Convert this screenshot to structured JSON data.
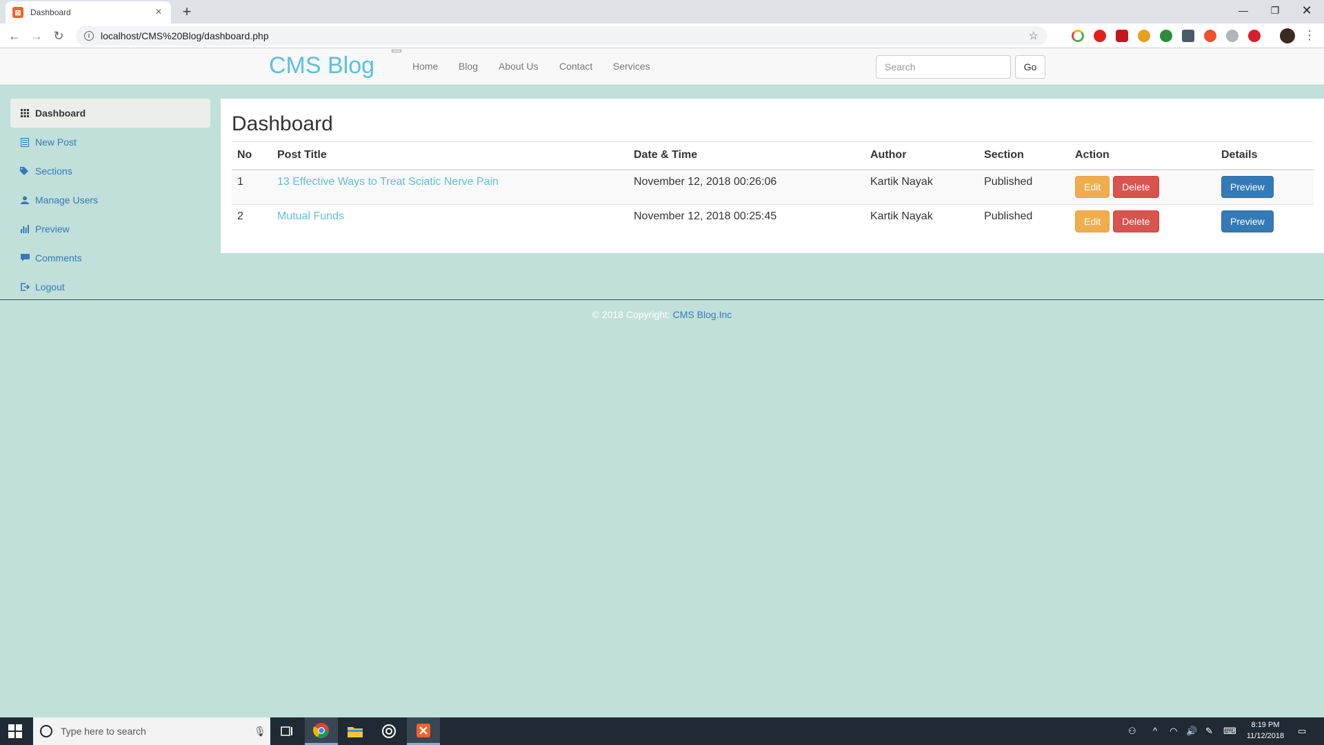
{
  "browser": {
    "tab_title": "Dashboard",
    "tab_favicon": "xampp-icon",
    "url": "localhost/CMS%20Blog/dashboard.php"
  },
  "site": {
    "brand": "CMS Blog",
    "nav": [
      "Home",
      "Blog",
      "About Us",
      "Contact",
      "Services"
    ],
    "search_placeholder": "Search",
    "go_label": "Go"
  },
  "sidebar": {
    "items": [
      {
        "label": "Dashboard",
        "icon": "grid-icon",
        "active": true
      },
      {
        "label": "New Post",
        "icon": "list-alt-icon"
      },
      {
        "label": "Sections",
        "icon": "tags-icon"
      },
      {
        "label": "Manage Users",
        "icon": "user-icon"
      },
      {
        "label": "Preview",
        "icon": "equalizer-icon"
      },
      {
        "label": "Comments",
        "icon": "comment-icon"
      },
      {
        "label": "Logout",
        "icon": "log-out-icon"
      }
    ]
  },
  "main": {
    "title": "Dashboard",
    "table": {
      "headers": [
        "No",
        "Post Title",
        "Date & Time",
        "Author",
        "Section",
        "Action",
        "Details"
      ],
      "rows": [
        {
          "no": "1",
          "title": "13 Effective Ways to Treat Sciatic Nerve Pain",
          "datetime": "November 12, 2018 00:26:06",
          "author": "Kartik Nayak",
          "section": "Published"
        },
        {
          "no": "2",
          "title": "Mutual Funds",
          "datetime": "November 12, 2018 00:25:45",
          "author": "Kartik Nayak",
          "section": "Published"
        }
      ],
      "edit_label": "Edit",
      "delete_label": "Delete",
      "preview_label": "Preview"
    }
  },
  "footer": {
    "copyright": "© 2018 Copyright: ",
    "company": "CMS Blog.Inc"
  },
  "taskbar": {
    "search_placeholder": "Type here to search",
    "time": "8:19 PM",
    "date": "11/12/2018"
  },
  "colors": {
    "page_bg": "#c1e0da",
    "brand": "#5bc0de",
    "link": "#337ab7",
    "edit": "#f0ad4e",
    "delete": "#d9534f",
    "preview": "#337ab7"
  }
}
